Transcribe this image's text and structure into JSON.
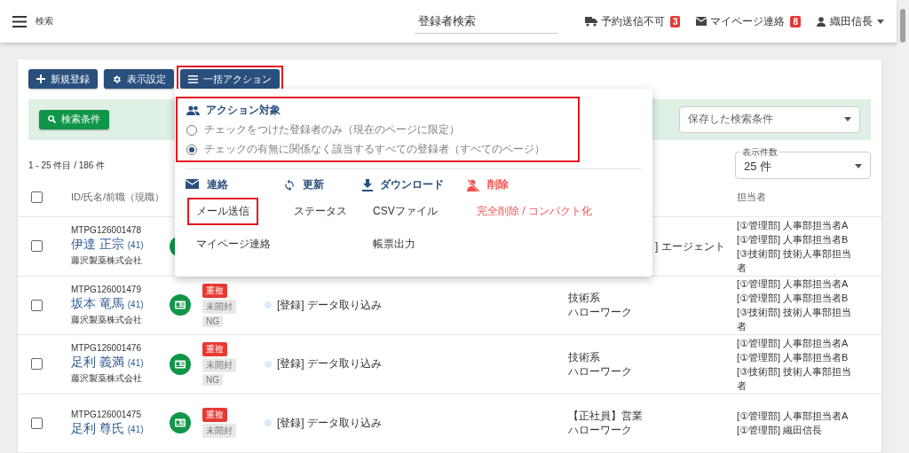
{
  "header": {
    "search_label": "検索",
    "search_placeholder": "登録者検索",
    "notices": [
      {
        "kind": "reservation",
        "label": "予約送信不可",
        "count": "3"
      },
      {
        "kind": "mail",
        "label": "マイページ連絡",
        "count": "8"
      }
    ],
    "user": "織田信長"
  },
  "toolbar": [
    {
      "kind": "add",
      "label": "新規登録",
      "highlighted": false
    },
    {
      "kind": "settings",
      "label": "表示設定",
      "highlighted": false
    },
    {
      "kind": "bulk",
      "label": "一括アクション",
      "highlighted": true
    }
  ],
  "filter": {
    "button": "検索条件",
    "saved_placeholder": "保存した検索条件"
  },
  "count_text": "1 - 25 件目 / 186 件",
  "per_page": {
    "label": "表示件数",
    "value": "25 件"
  },
  "select_all_checked": false,
  "columns": {
    "column_1": "ID/氏名/前職（現職）",
    "assignee": "担当者"
  },
  "rows": [
    {
      "covered": true,
      "checked": false,
      "id": "MTPG126001478",
      "name": "伊達 正宗",
      "age": "(41)",
      "company": "藤沢製薬株式会社",
      "tags": [],
      "job": [
        "] エージェント"
      ],
      "assignees": [
        "[①管理部] 人事部担当者A",
        "[①管理部] 人事部担当者B",
        "[③技術部] 技術人事部担当者"
      ]
    },
    {
      "covered": false,
      "checked": false,
      "id": "MTPG126001479",
      "name": "坂本 竜馬",
      "age": "(41)",
      "company": "藤沢製薬株式会社",
      "tags": [
        {
          "kind": "duplicate",
          "label": "重複"
        },
        {
          "kind": "muted",
          "label": "未開封"
        },
        {
          "kind": "muted",
          "label": "NG"
        }
      ],
      "status": "[登録] データ取り込み",
      "job": [
        "技術系",
        "ハローワーク"
      ],
      "assignees": [
        "[①管理部] 人事部担当者A",
        "[①管理部] 人事部担当者B",
        "[③技術部] 技術人事部担当者"
      ]
    },
    {
      "covered": false,
      "checked": false,
      "id": "MTPG126001476",
      "name": "足利 義満",
      "age": "(41)",
      "company": "藤沢製薬株式会社",
      "tags": [
        {
          "kind": "duplicate",
          "label": "重複"
        },
        {
          "kind": "muted",
          "label": "未開封"
        },
        {
          "kind": "muted",
          "label": "NG"
        }
      ],
      "status": "[登録] データ取り込み",
      "job": [
        "技術系",
        "ハローワーク"
      ],
      "assignees": [
        "[①管理部] 人事部担当者A",
        "[①管理部] 人事部担当者B",
        "[③技術部] 技術人事部担当者"
      ]
    },
    {
      "covered": false,
      "checked": false,
      "id": "MTPG126001475",
      "name": "足利 尊氏",
      "age": "(41)",
      "tags": [
        {
          "kind": "duplicate",
          "label": "重複"
        },
        {
          "kind": "muted",
          "label": "未開封"
        }
      ],
      "status": "[登録] データ取り込み",
      "job": [
        "【正社員】営業",
        "ハローワーク"
      ],
      "assignees": [
        "[①管理部] 人事部担当者A",
        "[①管理部] 織田信長"
      ]
    }
  ],
  "menu": {
    "target": {
      "title": "アクション対象",
      "highlighted": true,
      "options": [
        {
          "label": "チェックをつけた登録者のみ（現在のページに限定）",
          "selected": false
        },
        {
          "label": "チェックの有無に関係なく該当するすべての登録者（すべてのページ）",
          "selected": true
        }
      ]
    },
    "groups": [
      {
        "kind": "contact",
        "title": "連絡",
        "items": [
          {
            "label": "メール送信",
            "highlighted": true
          },
          {
            "label": "マイページ連絡",
            "highlighted": false
          }
        ]
      },
      {
        "kind": "update",
        "title": "更新",
        "items": [
          {
            "label": "ステータス",
            "highlighted": false
          }
        ]
      },
      {
        "kind": "download",
        "title": "ダウンロード",
        "items": [
          {
            "label": "CSVファイル",
            "highlighted": false
          },
          {
            "label": "帳票出力",
            "highlighted": false
          }
        ]
      },
      {
        "kind": "delete",
        "title": "削除",
        "items": [
          {
            "label": "完全削除 / コンパクト化",
            "highlighted": false
          }
        ]
      }
    ]
  }
}
